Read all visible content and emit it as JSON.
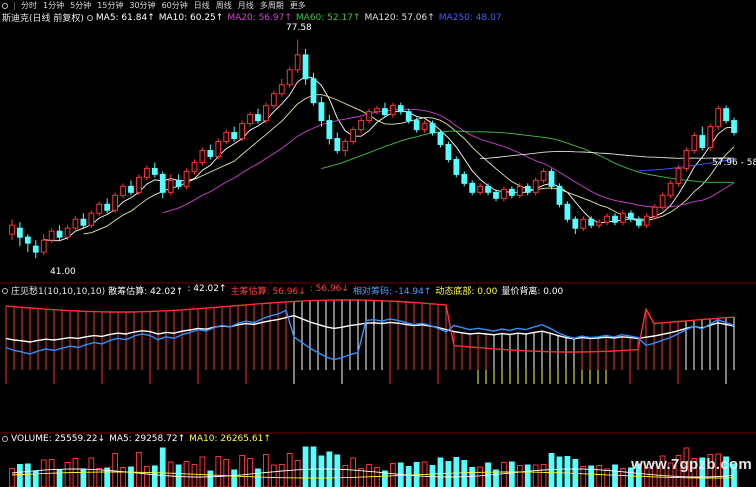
{
  "toolbar": {
    "items": [
      "分时",
      "1分钟",
      "5分钟",
      "15分钟",
      "30分钟",
      "60分钟",
      "日线",
      "周线",
      "月线",
      "多周期",
      "更多"
    ]
  },
  "main_chart": {
    "name": "斯迪克(日线 前复权)",
    "ma": [
      {
        "label": "MA5:",
        "value": "61.84",
        "arrow": "↑",
        "color": "#ffffff"
      },
      {
        "label": "MA10:",
        "value": "60.25",
        "arrow": "↑",
        "color": "#ffffff"
      },
      {
        "label": "MA20:",
        "value": "56.97",
        "arrow": "↑",
        "color": "#d040d0"
      },
      {
        "label": "MA60:",
        "value": "52.17",
        "arrow": "↑",
        "color": "#40c040"
      },
      {
        "label": "MA120:",
        "value": "57.06",
        "arrow": "↑",
        "color": "#e0e0e0"
      },
      {
        "label": "MA250:",
        "value": "48.07",
        "arrow": "",
        "color": "#4060ff"
      }
    ],
    "high_label": "77.58",
    "low_label": "41.00",
    "price_label": "57.96 - 58",
    "candles": [
      {
        "o": 45,
        "c": 46.5,
        "h": 47.5,
        "l": 44
      },
      {
        "o": 46,
        "c": 44.5,
        "h": 47,
        "l": 43
      },
      {
        "o": 44.5,
        "c": 43.5,
        "h": 45,
        "l": 42
      },
      {
        "o": 43,
        "c": 42,
        "h": 44,
        "l": 41
      },
      {
        "o": 42,
        "c": 44,
        "h": 45,
        "l": 41.5
      },
      {
        "o": 44,
        "c": 45.5,
        "h": 46,
        "l": 43.5
      },
      {
        "o": 45.5,
        "c": 44.5,
        "h": 46.5,
        "l": 44
      },
      {
        "o": 44.5,
        "c": 46,
        "h": 46.5,
        "l": 44
      },
      {
        "o": 46,
        "c": 47.5,
        "h": 48,
        "l": 45.5
      },
      {
        "o": 47.5,
        "c": 46.5,
        "h": 48.5,
        "l": 46
      },
      {
        "o": 46.5,
        "c": 48.5,
        "h": 49,
        "l": 46
      },
      {
        "o": 48.5,
        "c": 50,
        "h": 50.5,
        "l": 48
      },
      {
        "o": 50,
        "c": 49,
        "h": 51,
        "l": 48.5
      },
      {
        "o": 49,
        "c": 51.5,
        "h": 52,
        "l": 48.5
      },
      {
        "o": 51.5,
        "c": 53,
        "h": 53.5,
        "l": 51
      },
      {
        "o": 53,
        "c": 52,
        "h": 54,
        "l": 51.5
      },
      {
        "o": 52,
        "c": 54.5,
        "h": 55,
        "l": 51.5
      },
      {
        "o": 54.5,
        "c": 56,
        "h": 56.5,
        "l": 54
      },
      {
        "o": 56,
        "c": 55,
        "h": 57,
        "l": 54.5
      },
      {
        "o": 55,
        "c": 52,
        "h": 55.5,
        "l": 51
      },
      {
        "o": 52,
        "c": 54,
        "h": 55,
        "l": 51.5
      },
      {
        "o": 54,
        "c": 53,
        "h": 55,
        "l": 52.5
      },
      {
        "o": 53,
        "c": 55.5,
        "h": 56,
        "l": 52.5
      },
      {
        "o": 55.5,
        "c": 57,
        "h": 57.5,
        "l": 55
      },
      {
        "o": 57,
        "c": 59,
        "h": 59.5,
        "l": 56.5
      },
      {
        "o": 59,
        "c": 58,
        "h": 60,
        "l": 57.5
      },
      {
        "o": 58,
        "c": 60.5,
        "h": 61,
        "l": 57.5
      },
      {
        "o": 60.5,
        "c": 62,
        "h": 62.5,
        "l": 60
      },
      {
        "o": 62,
        "c": 61,
        "h": 63,
        "l": 60.5
      },
      {
        "o": 61,
        "c": 63.5,
        "h": 64,
        "l": 60.5
      },
      {
        "o": 63.5,
        "c": 65,
        "h": 65.5,
        "l": 63
      },
      {
        "o": 65,
        "c": 64,
        "h": 66,
        "l": 63.5
      },
      {
        "o": 64,
        "c": 66.5,
        "h": 67,
        "l": 63.5
      },
      {
        "o": 66.5,
        "c": 68.5,
        "h": 69,
        "l": 66
      },
      {
        "o": 68.5,
        "c": 70,
        "h": 71,
        "l": 68
      },
      {
        "o": 70,
        "c": 72.5,
        "h": 73,
        "l": 69.5
      },
      {
        "o": 72.5,
        "c": 75,
        "h": 77.58,
        "l": 72
      },
      {
        "o": 75,
        "c": 71,
        "h": 76,
        "l": 70
      },
      {
        "o": 71,
        "c": 67,
        "h": 72,
        "l": 66.5
      },
      {
        "o": 67,
        "c": 64,
        "h": 68,
        "l": 63
      },
      {
        "o": 64,
        "c": 61,
        "h": 65,
        "l": 60
      },
      {
        "o": 61,
        "c": 59,
        "h": 62,
        "l": 58.5
      },
      {
        "o": 59,
        "c": 60.5,
        "h": 61,
        "l": 58
      },
      {
        "o": 60.5,
        "c": 62.5,
        "h": 63,
        "l": 60
      },
      {
        "o": 62.5,
        "c": 64,
        "h": 64.5,
        "l": 62
      },
      {
        "o": 64,
        "c": 65.5,
        "h": 66,
        "l": 63.5
      },
      {
        "o": 65.5,
        "c": 66,
        "h": 66.5,
        "l": 65
      },
      {
        "o": 66,
        "c": 65,
        "h": 67,
        "l": 64.5
      },
      {
        "o": 65,
        "c": 66.5,
        "h": 67,
        "l": 64.5
      },
      {
        "o": 66.5,
        "c": 65.5,
        "h": 67,
        "l": 65
      },
      {
        "o": 65.5,
        "c": 64,
        "h": 66,
        "l": 63.5
      },
      {
        "o": 64,
        "c": 62.5,
        "h": 64.5,
        "l": 62
      },
      {
        "o": 62.5,
        "c": 63.5,
        "h": 64,
        "l": 62
      },
      {
        "o": 63.5,
        "c": 62,
        "h": 64,
        "l": 61.5
      },
      {
        "o": 62,
        "c": 60,
        "h": 62.5,
        "l": 59.5
      },
      {
        "o": 60,
        "c": 57.5,
        "h": 60.5,
        "l": 57
      },
      {
        "o": 57.5,
        "c": 55,
        "h": 58,
        "l": 54.5
      },
      {
        "o": 55,
        "c": 53.5,
        "h": 55.5,
        "l": 53
      },
      {
        "o": 53.5,
        "c": 52,
        "h": 54,
        "l": 51.5
      },
      {
        "o": 52,
        "c": 53,
        "h": 53.5,
        "l": 51.5
      },
      {
        "o": 53,
        "c": 52,
        "h": 53.5,
        "l": 51.5
      },
      {
        "o": 52,
        "c": 51,
        "h": 52.5,
        "l": 50.5
      },
      {
        "o": 51,
        "c": 52.5,
        "h": 53,
        "l": 50.5
      },
      {
        "o": 52.5,
        "c": 51.5,
        "h": 53,
        "l": 51
      },
      {
        "o": 51.5,
        "c": 53,
        "h": 53.5,
        "l": 51
      },
      {
        "o": 53,
        "c": 52,
        "h": 53.5,
        "l": 51.5
      },
      {
        "o": 52,
        "c": 54,
        "h": 54.5,
        "l": 51.5
      },
      {
        "o": 54,
        "c": 55.5,
        "h": 56,
        "l": 53.5
      },
      {
        "o": 55.5,
        "c": 53,
        "h": 56,
        "l": 52.5
      },
      {
        "o": 53,
        "c": 50,
        "h": 53.5,
        "l": 49.5
      },
      {
        "o": 50,
        "c": 47.5,
        "h": 50.5,
        "l": 47
      },
      {
        "o": 47.5,
        "c": 46,
        "h": 48,
        "l": 45
      },
      {
        "o": 46,
        "c": 47.5,
        "h": 48,
        "l": 45.5
      },
      {
        "o": 47.5,
        "c": 46.5,
        "h": 48,
        "l": 46
      },
      {
        "o": 46.5,
        "c": 47,
        "h": 47.5,
        "l": 46
      },
      {
        "o": 47,
        "c": 48,
        "h": 48.5,
        "l": 46.5
      },
      {
        "o": 48,
        "c": 47,
        "h": 48.5,
        "l": 46.5
      },
      {
        "o": 47,
        "c": 48.5,
        "h": 49,
        "l": 46.5
      },
      {
        "o": 48.5,
        "c": 47.5,
        "h": 49,
        "l": 47
      },
      {
        "o": 47.5,
        "c": 46.5,
        "h": 48,
        "l": 46
      },
      {
        "o": 46.5,
        "c": 48,
        "h": 48.5,
        "l": 46
      },
      {
        "o": 48,
        "c": 49.5,
        "h": 50,
        "l": 47.5
      },
      {
        "o": 49.5,
        "c": 51.5,
        "h": 52,
        "l": 49
      },
      {
        "o": 51.5,
        "c": 53.5,
        "h": 54,
        "l": 51
      },
      {
        "o": 53.5,
        "c": 56,
        "h": 56.5,
        "l": 53
      },
      {
        "o": 56,
        "c": 59,
        "h": 59.5,
        "l": 55.5
      },
      {
        "o": 59,
        "c": 61.5,
        "h": 62,
        "l": 58.5
      },
      {
        "o": 61.5,
        "c": 59.5,
        "h": 63,
        "l": 59
      },
      {
        "o": 59.5,
        "c": 63,
        "h": 63.5,
        "l": 59
      },
      {
        "o": 63,
        "c": 66,
        "h": 66.5,
        "l": 62.5
      },
      {
        "o": 66,
        "c": 64,
        "h": 66.5,
        "l": 63.5
      },
      {
        "o": 64,
        "c": 62,
        "h": 64.5,
        "l": 61.5
      }
    ]
  },
  "indicator_chart": {
    "title": "庄见愁1(10,10,10,10)",
    "items": [
      {
        "label": "散筹估算:",
        "value": "42.02",
        "arrow": "↑",
        "color": "#ffffff"
      },
      {
        "label": ":",
        "value": "42.02",
        "arrow": "↑",
        "color": "#ffffff"
      },
      {
        "label": "主筹估算:",
        "value": "56.96",
        "arrow": "↓",
        "color": "#ff4040"
      },
      {
        "label": ":",
        "value": "56.96",
        "arrow": "↓",
        "color": "#ff4040"
      },
      {
        "label": "相对筹码:",
        "value": "-14.94",
        "arrow": "↑",
        "color": "#4aa0ff"
      },
      {
        "label": "动态底部:",
        "value": "0.00",
        "arrow": "",
        "color": "#ffff40"
      },
      {
        "label": "量价背离:",
        "value": "0.00",
        "arrow": "",
        "color": "#ffffff"
      }
    ]
  },
  "volume_chart": {
    "items": [
      {
        "label": "VOLUME:",
        "value": "25559.22",
        "arrow": "↓",
        "color": "#ffffff"
      },
      {
        "label": "MA5:",
        "value": "29258.72",
        "arrow": "↑",
        "color": "#ffffff"
      },
      {
        "label": "MA10:",
        "value": "26265.61",
        "arrow": "↑",
        "color": "#ffff40"
      }
    ]
  },
  "watermark": "www.7gpzb.com",
  "colors": {
    "up": "#ff3232",
    "down": "#54ffff",
    "bg": "#000000",
    "grid": "#7a0000"
  }
}
